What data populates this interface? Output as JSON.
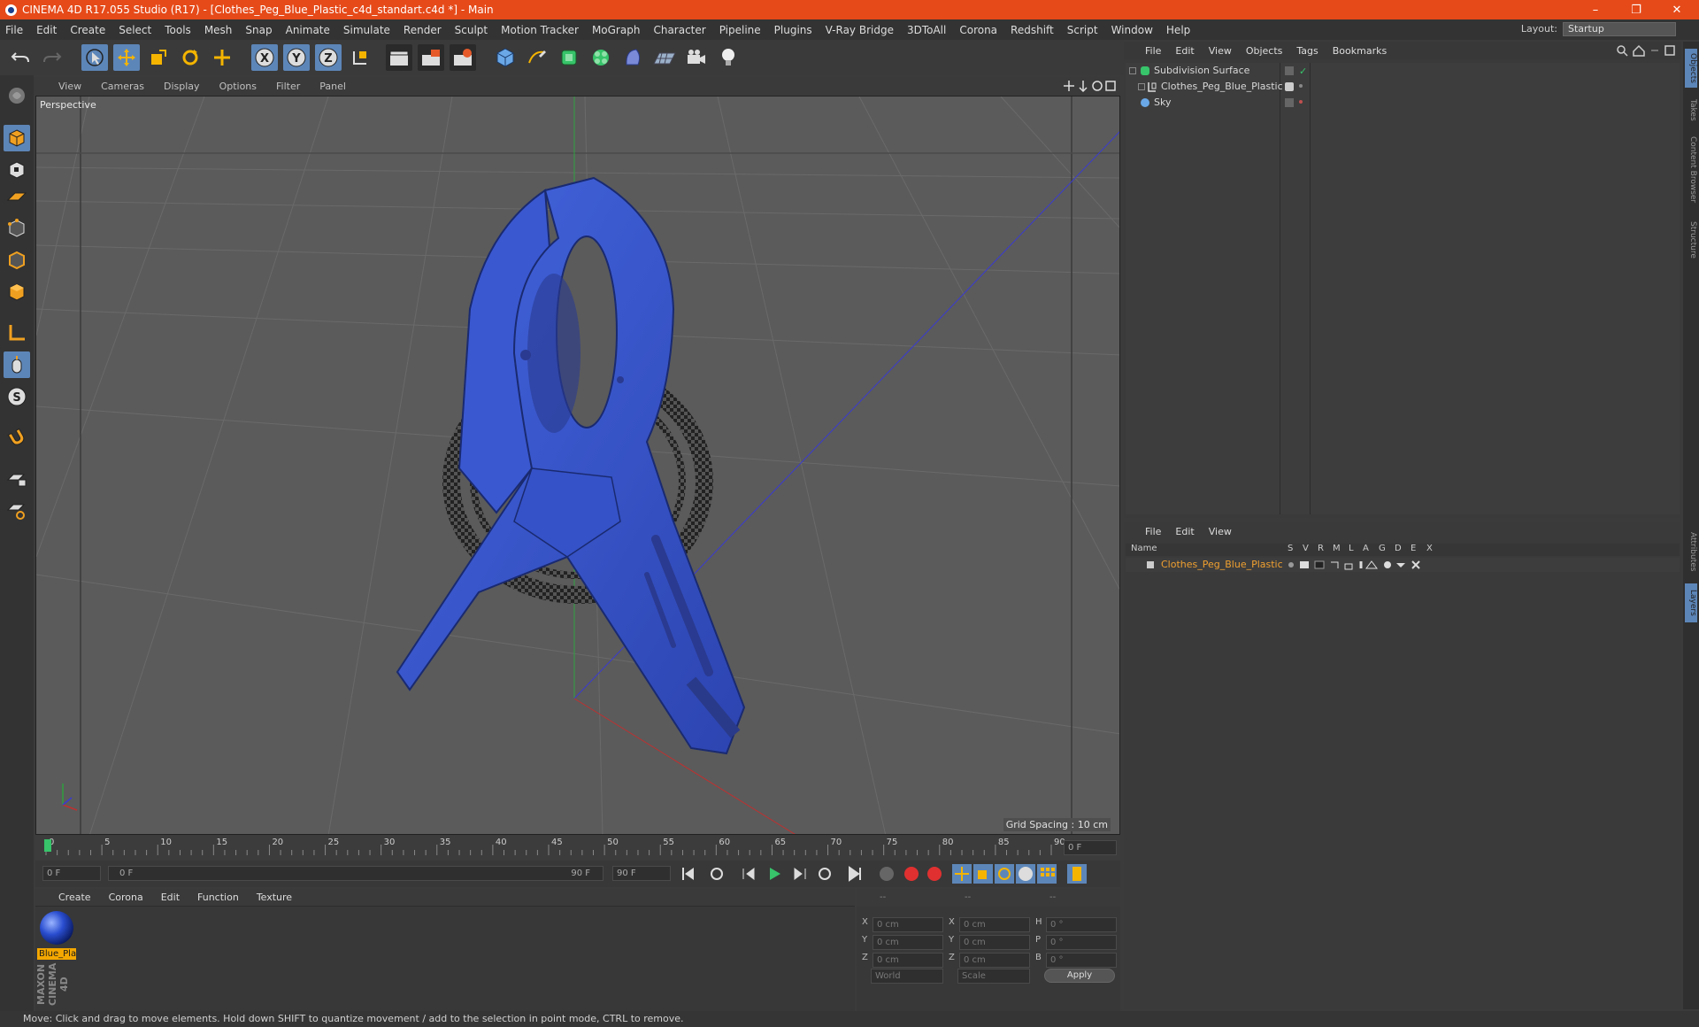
{
  "window": {
    "title": "CINEMA 4D R17.055 Studio (R17) - [Clothes_Peg_Blue_Plastic_c4d_standart.c4d *] - Main",
    "controls": [
      "–",
      "❐",
      "✕"
    ]
  },
  "menubar": {
    "items": [
      "File",
      "Edit",
      "Create",
      "Select",
      "Tools",
      "Mesh",
      "Snap",
      "Animate",
      "Simulate",
      "Render",
      "Sculpt",
      "Motion Tracker",
      "MoGraph",
      "Character",
      "Pipeline",
      "Plugins",
      "V-Ray Bridge",
      "3DToAll",
      "Corona",
      "Redshift",
      "Script",
      "Window",
      "Help"
    ],
    "layout_label": "Layout:",
    "layout_value": "Startup"
  },
  "viewport": {
    "menu": [
      "View",
      "Cameras",
      "Display",
      "Options",
      "Filter",
      "Panel"
    ],
    "label": "Perspective",
    "grid_spacing": "Grid Spacing : 10 cm"
  },
  "timeline": {
    "ticks": [
      "0",
      "5",
      "10",
      "15",
      "20",
      "25",
      "30",
      "35",
      "40",
      "45",
      "50",
      "55",
      "60",
      "65",
      "70",
      "75",
      "80",
      "85",
      "90"
    ],
    "current_frame": "0 F",
    "start_field": "0 F",
    "range_start": "0 F",
    "range_end": "90 F",
    "end_field": "90 F"
  },
  "material_manager": {
    "menu": [
      "Create",
      "Corona",
      "Edit",
      "Function",
      "Texture"
    ],
    "materials": [
      {
        "name": "Blue_Pla"
      }
    ]
  },
  "coordinates": {
    "headers": [
      "--",
      "--",
      "--"
    ],
    "rows": [
      {
        "axis": "X",
        "pos": "0 cm",
        "axis2": "X",
        "size": "0 cm",
        "raxis": "H",
        "rot": "0 °"
      },
      {
        "axis": "Y",
        "pos": "0 cm",
        "axis2": "Y",
        "size": "0 cm",
        "raxis": "P",
        "rot": "0 °"
      },
      {
        "axis": "Z",
        "pos": "0 cm",
        "axis2": "Z",
        "size": "0 cm",
        "raxis": "B",
        "rot": "0 °"
      }
    ],
    "mode": "World",
    "size_mode": "Scale",
    "apply": "Apply"
  },
  "object_manager": {
    "menu": [
      "File",
      "Edit",
      "View",
      "Objects",
      "Tags",
      "Bookmarks"
    ],
    "objects": [
      {
        "name": "Subdivision Surface"
      },
      {
        "name": "Clothes_Peg_Blue_Plastic"
      },
      {
        "name": "Sky"
      }
    ]
  },
  "layer_manager": {
    "menu": [
      "File",
      "Edit",
      "View"
    ],
    "columns": [
      "Name",
      "S",
      "V",
      "R",
      "M",
      "L",
      "A",
      "G",
      "D",
      "E",
      "X"
    ],
    "layers": [
      {
        "name": "Clothes_Peg_Blue_Plastic"
      }
    ]
  },
  "side_tabs": [
    "Objects",
    "Takes",
    "Content Browser",
    "Structure",
    "Attributes",
    "Layers"
  ],
  "branding": "MAXON CINEMA 4D",
  "status": "Move: Click and drag to move elements. Hold down SHIFT to quantize movement / add to the selection in point mode, CTRL to remove.",
  "colors": {
    "titlebar": "#e64a19",
    "accent_blue": "#5d86b8",
    "peg_blue": "#3552c8",
    "layer_name": "#f0a030"
  }
}
